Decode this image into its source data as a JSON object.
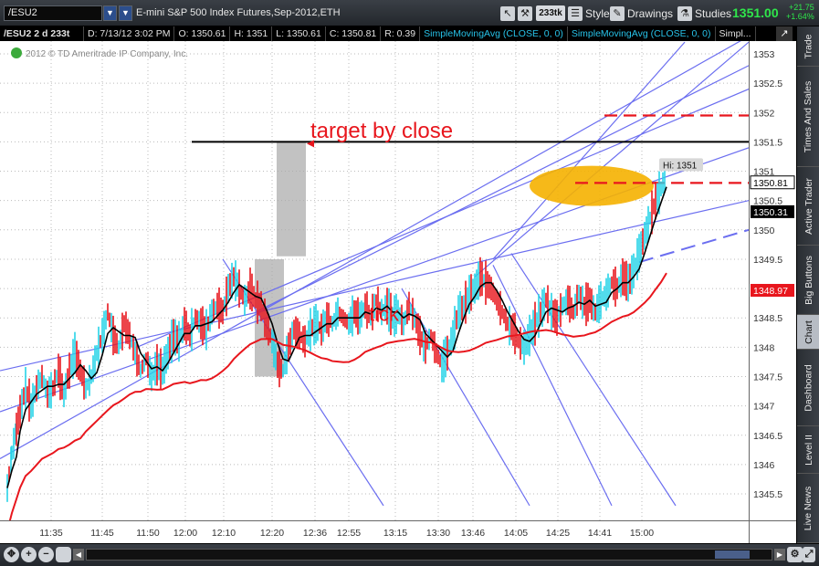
{
  "toolbar": {
    "symbol": "/ESU2",
    "description": "E-mini S&P 500 Index Futures,Sep-2012,ETH",
    "aggregation": "233tk",
    "style_label": "Style",
    "drawings_label": "Drawings",
    "studies_label": "Studies",
    "last_price": "1351.00",
    "change_abs": "+21.75",
    "change_pct": "+1.64%"
  },
  "infobar": {
    "symbol_period": "/ESU2 2 d 233t",
    "date": "D: 7/13/12 3:02 PM",
    "open": "O: 1350.61",
    "high": "H: 1351",
    "low": "L: 1350.61",
    "close": "C: 1350.81",
    "range": "R: 0.39",
    "study1": "SimpleMovingAvg (CLOSE, 0, 0)",
    "study2": "SimpleMovingAvg (CLOSE, 0, 0)",
    "study3": "Simpl..."
  },
  "chart": {
    "watermark": "2012 © TD Ameritrade IP Company, Inc.",
    "annotation_target": "target by close",
    "annotation_tick": "tick",
    "hi_label": "Hi: 1351",
    "price_tags": {
      "close": "1350.81",
      "sma_fast": "1350.31",
      "sma_slow": "1348.97"
    },
    "colors": {
      "up_bar": "#27d3e8",
      "down_bar": "#e8161d",
      "sma_fast": "#000000",
      "sma_slow": "#e8161d",
      "trendline": "#6b6ef0",
      "target_line": "#000000",
      "dashed_red": "#e8161d",
      "ellipse": "#f5b100",
      "shade": "#a8a8a8"
    }
  },
  "chart_data": {
    "type": "candlestick",
    "title": "",
    "y_ticks": [
      "1353",
      "1352.5",
      "1352",
      "1351.5",
      "1351",
      "1350.5",
      "1350",
      "1349.5",
      "1349",
      "1348.5",
      "1348",
      "1347.5",
      "1347",
      "1346.5",
      "1346",
      "1345.5"
    ],
    "x_ticks": [
      "11:35",
      "11:45",
      "11:50",
      "12:00",
      "12:10",
      "12:20",
      "12:36",
      "12:55",
      "13:15",
      "13:30",
      "13:46",
      "14:05",
      "14:25",
      "14:41",
      "15:00"
    ],
    "ylim": [
      1345.3,
      1353.1
    ],
    "price_path": [
      [
        0,
        1345.6
      ],
      [
        5,
        1346.2
      ],
      [
        10,
        1346.6
      ],
      [
        14,
        1346.9
      ],
      [
        20,
        1347.3
      ],
      [
        26,
        1347.0
      ],
      [
        32,
        1347.3
      ],
      [
        38,
        1347.5
      ],
      [
        44,
        1347.2
      ],
      [
        50,
        1347.3
      ],
      [
        56,
        1347.6
      ],
      [
        62,
        1347.2
      ],
      [
        68,
        1347.6
      ],
      [
        74,
        1347.9
      ],
      [
        80,
        1347.6
      ],
      [
        86,
        1347.3
      ],
      [
        92,
        1347.5
      ],
      [
        98,
        1347.9
      ],
      [
        104,
        1348.2
      ],
      [
        110,
        1348.6
      ],
      [
        116,
        1348.2
      ],
      [
        122,
        1348.0
      ],
      [
        128,
        1348.4
      ],
      [
        134,
        1348.2
      ],
      [
        140,
        1347.9
      ],
      [
        146,
        1347.6
      ],
      [
        152,
        1347.8
      ],
      [
        158,
        1347.5
      ],
      [
        164,
        1347.7
      ],
      [
        170,
        1347.6
      ],
      [
        176,
        1347.9
      ],
      [
        182,
        1348.2
      ],
      [
        188,
        1348.1
      ],
      [
        194,
        1348.4
      ],
      [
        200,
        1348.2
      ],
      [
        206,
        1348.5
      ],
      [
        212,
        1348.4
      ],
      [
        218,
        1348.3
      ],
      [
        224,
        1348.6
      ],
      [
        230,
        1348.7
      ],
      [
        236,
        1348.6
      ],
      [
        242,
        1349.0
      ],
      [
        248,
        1349.2
      ],
      [
        254,
        1349.0
      ],
      [
        260,
        1348.8
      ],
      [
        266,
        1349.0
      ],
      [
        272,
        1348.8
      ],
      [
        278,
        1348.7
      ],
      [
        284,
        1348.4
      ],
      [
        290,
        1348.1
      ],
      [
        296,
        1347.7
      ],
      [
        302,
        1347.6
      ],
      [
        308,
        1348.0
      ],
      [
        314,
        1348.3
      ],
      [
        320,
        1348.2
      ],
      [
        326,
        1348.1
      ],
      [
        332,
        1348.3
      ],
      [
        338,
        1348.4
      ],
      [
        344,
        1348.3
      ],
      [
        350,
        1348.5
      ],
      [
        356,
        1348.4
      ],
      [
        362,
        1348.6
      ],
      [
        368,
        1348.5
      ],
      [
        374,
        1348.4
      ],
      [
        380,
        1348.6
      ],
      [
        386,
        1348.5
      ],
      [
        392,
        1348.7
      ],
      [
        398,
        1348.5
      ],
      [
        404,
        1348.8
      ],
      [
        410,
        1348.6
      ],
      [
        416,
        1348.7
      ],
      [
        422,
        1348.5
      ],
      [
        428,
        1348.6
      ],
      [
        434,
        1348.4
      ],
      [
        440,
        1348.7
      ],
      [
        446,
        1348.5
      ],
      [
        452,
        1348.2
      ],
      [
        458,
        1348.0
      ],
      [
        464,
        1348.2
      ],
      [
        470,
        1347.9
      ],
      [
        476,
        1347.7
      ],
      [
        482,
        1347.9
      ],
      [
        488,
        1348.2
      ],
      [
        494,
        1348.6
      ],
      [
        500,
        1348.7
      ],
      [
        506,
        1348.9
      ],
      [
        512,
        1349.0
      ],
      [
        518,
        1349.2
      ],
      [
        524,
        1349.1
      ],
      [
        530,
        1349.0
      ],
      [
        536,
        1348.8
      ],
      [
        542,
        1348.6
      ],
      [
        548,
        1348.4
      ],
      [
        554,
        1348.3
      ],
      [
        560,
        1348.1
      ],
      [
        566,
        1348.0
      ],
      [
        572,
        1348.2
      ],
      [
        578,
        1348.4
      ],
      [
        584,
        1348.6
      ],
      [
        590,
        1348.8
      ],
      [
        596,
        1348.6
      ],
      [
        602,
        1348.5
      ],
      [
        608,
        1348.7
      ],
      [
        614,
        1348.8
      ],
      [
        620,
        1348.6
      ],
      [
        626,
        1348.9
      ],
      [
        632,
        1348.7
      ],
      [
        638,
        1348.8
      ],
      [
        644,
        1348.6
      ],
      [
        650,
        1348.8
      ],
      [
        656,
        1348.9
      ],
      [
        662,
        1349.1
      ],
      [
        668,
        1349.0
      ],
      [
        674,
        1349.2
      ],
      [
        680,
        1349.1
      ],
      [
        686,
        1349.3
      ],
      [
        692,
        1349.6
      ],
      [
        698,
        1349.9
      ],
      [
        704,
        1350.2
      ],
      [
        710,
        1350.5
      ],
      [
        716,
        1350.7
      ],
      [
        722,
        1351.0
      ]
    ]
  },
  "sidetabs": [
    "Trade",
    "Times And Sales",
    "Active Trader",
    "Big Buttons",
    "Chart",
    "Dashboard",
    "Level II",
    "Live News"
  ]
}
